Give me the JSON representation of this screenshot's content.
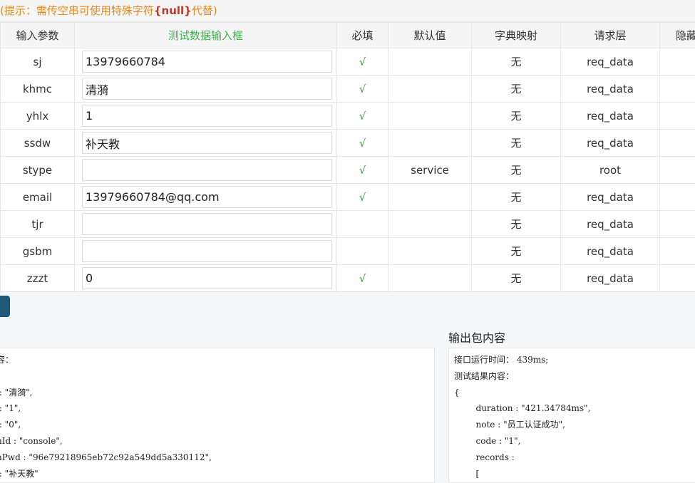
{
  "hint": {
    "prefix": "(提示：需传空串可使用特殊字符",
    "null_token": "{null}",
    "suffix": "代替)"
  },
  "table": {
    "headers": {
      "param": "输入参数",
      "test_input": "测试数据输入框",
      "required": "必填",
      "default": "默认值",
      "dict": "字典映射",
      "layer": "请求层",
      "hidden": "隐藏"
    },
    "rows": [
      {
        "param": "sj",
        "value": "13979660784",
        "required": "√",
        "default": "",
        "dict": "无",
        "layer": "req_data"
      },
      {
        "param": "khmc",
        "value": "清漪",
        "required": "√",
        "default": "",
        "dict": "无",
        "layer": "req_data"
      },
      {
        "param": "yhlx",
        "value": "1",
        "required": "√",
        "default": "",
        "dict": "无",
        "layer": "req_data"
      },
      {
        "param": "ssdw",
        "value": "补天教",
        "required": "√",
        "default": "",
        "dict": "无",
        "layer": "req_data"
      },
      {
        "param": "stype",
        "value": "",
        "required": "√",
        "default": "service",
        "dict": "无",
        "layer": "root"
      },
      {
        "param": "email",
        "value": "13979660784@qq.com",
        "required": "√",
        "default": "",
        "dict": "无",
        "layer": "req_data"
      },
      {
        "param": "tjr",
        "value": "",
        "required": "",
        "default": "",
        "dict": "无",
        "layer": "req_data"
      },
      {
        "param": "gsbm",
        "value": "",
        "required": "",
        "default": "",
        "dict": "无",
        "layer": "req_data"
      },
      {
        "param": "zzzt",
        "value": "0",
        "required": "√",
        "default": "",
        "dict": "无",
        "layer": "req_data"
      }
    ]
  },
  "input_panel": {
    "lines": [
      "容：",
      "",
      " : \"清漪\",",
      " : \"1\",",
      " : \"0\",",
      "nId : \"console\",",
      "nPwd : \"96e79218965eb72c92a549dd5a330112\",",
      " : \"补天教\""
    ]
  },
  "output_panel": {
    "title": "输出包内容",
    "lines": [
      "接口运行时间： 439ms;",
      "测试结果内容：",
      "{",
      "        duration : \"421.34784ms\",",
      "        note : \"员工认证成功\",",
      "        code : \"1\",",
      "        records :",
      "        ["
    ]
  },
  "colors": {
    "hint": "#e88a1a",
    "null_token": "#c0392b",
    "check": "#2aa33a",
    "run_button": "#1e5a7a"
  }
}
